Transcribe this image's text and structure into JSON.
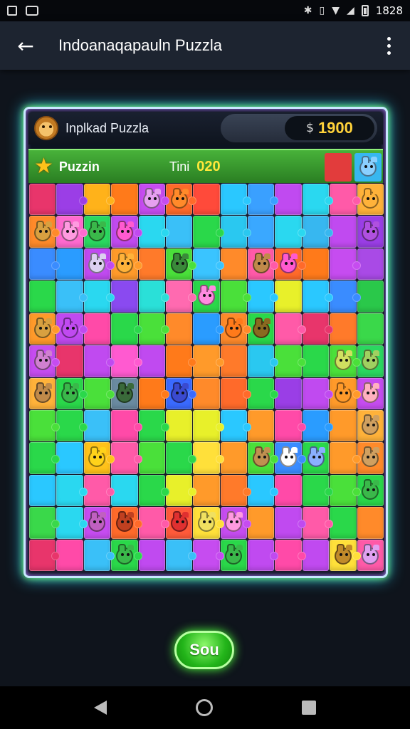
{
  "status_bar": {
    "time": "1828"
  },
  "app_bar": {
    "title": "Indoanaqapauln Puzzla"
  },
  "panel": {
    "title": "Inplkad Puzzla",
    "coin_symbol": "$",
    "coins": "1900"
  },
  "info_bar": {
    "label": "Puzzin",
    "timer_label": "Tini",
    "timer_value": "020"
  },
  "colors": {
    "corner_tiles": [
      "#e23c3c",
      "#37b7f0"
    ],
    "grid": [
      [
        "#e8356b",
        "#9b3ee6",
        "#ffb21a",
        "#ff7a1a",
        "#c64cf0",
        "#ff6a2a",
        "#ff4a3a",
        "#2ac8ff",
        "#3aa0ff",
        "#c04af0",
        "#2ad8f0",
        "#ff5aa8",
        "#ffb23a"
      ],
      [
        "#ff8a2a",
        "#ff6ad0",
        "#2ad860",
        "#c04af0",
        "#2ad8f0",
        "#3ac0f8",
        "#2ad84a",
        "#2ac8f0",
        "#3aa8ff",
        "#2ad8f0",
        "#37b7f0",
        "#c04af0",
        "#9a3ee6"
      ],
      [
        "#3a8cff",
        "#2a9cff",
        "#c04af0",
        "#ff9a2a",
        "#ff7a2a",
        "#4ae03a",
        "#3ac4ff",
        "#ff8a2a",
        "#ff5aa8",
        "#ff6a2a",
        "#ff7a1a",
        "#c64cf0",
        "#a94ae6"
      ],
      [
        "#2ad84a",
        "#3ac0f8",
        "#2ad8f0",
        "#8a4af0",
        "#2ae0d8",
        "#ff6ab0",
        "#2ad84a",
        "#4ae03a",
        "#2ac8ff",
        "#e8f02a",
        "#2ac8ff",
        "#3a8cff",
        "#2ac84a"
      ],
      [
        "#ff9a2a",
        "#c04af0",
        "#ff4aa8",
        "#2ad84a",
        "#4ae03a",
        "#ff8a2a",
        "#2a9cff",
        "#ff8a2a",
        "#2ad84a",
        "#ff5aa8",
        "#e8356b",
        "#ff7a2a",
        "#3ad84a"
      ],
      [
        "#c64cf0",
        "#e8356b",
        "#c04af0",
        "#ff5ad0",
        "#c04af0",
        "#ff7a1a",
        "#ff9a2a",
        "#ff7a2a",
        "#2ac8f0",
        "#4ae03a",
        "#2ad84a",
        "#4ae03a",
        "#2ad860"
      ],
      [
        "#ffb23a",
        "#2ad84a",
        "#4ae03a",
        "#6a8aa0",
        "#ff7a1a",
        "#3a6aff",
        "#ff8a2a",
        "#ff6a2a",
        "#2ad84a",
        "#9a3ee6",
        "#c04af0",
        "#ff9a2a",
        "#c64cf0"
      ],
      [
        "#4ae03a",
        "#2ad84a",
        "#3ac0f8",
        "#ff4aa8",
        "#2ad84a",
        "#e8f02a",
        "#e8f02a",
        "#2ac8ff",
        "#ff9a2a",
        "#ff4aa8",
        "#2a9cff",
        "#ff9a2a",
        "#ffb23a"
      ],
      [
        "#2ad84a",
        "#2ac8ff",
        "#ffc21a",
        "#ff5aa8",
        "#4ae03a",
        "#2ad84a",
        "#ffe03a",
        "#ff9a2a",
        "#4ae03a",
        "#3a8cff",
        "#2ad84a",
        "#ff9a2a",
        "#ff8a2a"
      ],
      [
        "#2ac8ff",
        "#2ad8f0",
        "#ff5aa8",
        "#2ad8f0",
        "#2ad84a",
        "#e8f02a",
        "#ff9a2a",
        "#ff7a2a",
        "#2ac8ff",
        "#ff4aa8",
        "#2ad84a",
        "#4ae03a",
        "#2ad84a"
      ],
      [
        "#3ad84a",
        "#2ad8f0",
        "#c64cf0",
        "#ff6a2a",
        "#ff5aa8",
        "#ff5a3a",
        "#ffe03a",
        "#c64cf0",
        "#ff9a2a",
        "#c04af0",
        "#ff5aa8",
        "#2ad84a",
        "#ff8a2a"
      ],
      [
        "#e8356b",
        "#ff4aa8",
        "#3ac0f8",
        "#2ad84a",
        "#c04af0",
        "#3ac0f8",
        "#c64cf0",
        "#2ad84a",
        "#c04af0",
        "#ff4aa8",
        "#c04af0",
        "#ffe03a",
        "#ff5aa8"
      ]
    ],
    "critters": [
      [
        0,
        4,
        "#e6a0f0"
      ],
      [
        0,
        5,
        "#ff8a2a"
      ],
      [
        0,
        12,
        "#ffb23a"
      ],
      [
        1,
        0,
        "#d8a040"
      ],
      [
        1,
        1,
        "#ff9ae0"
      ],
      [
        1,
        2,
        "#3ab84a"
      ],
      [
        1,
        3,
        "#ff5ad0"
      ],
      [
        1,
        12,
        "#b050e0"
      ],
      [
        2,
        2,
        "#dcd0f0"
      ],
      [
        2,
        3,
        "#ffb23a"
      ],
      [
        2,
        5,
        "#3a8a3a"
      ],
      [
        2,
        8,
        "#c08a4a"
      ],
      [
        2,
        9,
        "#ff5ad0"
      ],
      [
        3,
        6,
        "#ff8ae0"
      ],
      [
        4,
        0,
        "#d8a040"
      ],
      [
        4,
        1,
        "#c04af0"
      ],
      [
        4,
        7,
        "#ff7a1a"
      ],
      [
        4,
        8,
        "#8a6a20"
      ],
      [
        5,
        0,
        "#d080d0"
      ],
      [
        5,
        11,
        "#d0e060"
      ],
      [
        5,
        12,
        "#a0d060"
      ],
      [
        6,
        0,
        "#c08a4a"
      ],
      [
        6,
        1,
        "#3ab84a"
      ],
      [
        6,
        3,
        "#3a6a3a"
      ],
      [
        6,
        5,
        "#3a4ad0"
      ],
      [
        6,
        11,
        "#ff9a2a"
      ],
      [
        6,
        12,
        "#ffb0c0"
      ],
      [
        7,
        12,
        "#d0a060"
      ],
      [
        8,
        2,
        "#ffd21a"
      ],
      [
        8,
        8,
        "#c09050"
      ],
      [
        8,
        9,
        "#ffffff"
      ],
      [
        8,
        10,
        "#8ab0ff"
      ],
      [
        8,
        12,
        "#d0a060"
      ],
      [
        9,
        12,
        "#3ab84a"
      ],
      [
        10,
        2,
        "#c060c0"
      ],
      [
        10,
        3,
        "#c04020"
      ],
      [
        10,
        5,
        "#e03030"
      ],
      [
        10,
        6,
        "#f0e060"
      ],
      [
        10,
        7,
        "#ff9ae0"
      ],
      [
        11,
        3,
        "#3ab84a"
      ],
      [
        11,
        7,
        "#3ab84a"
      ],
      [
        11,
        11,
        "#c08a2a"
      ],
      [
        11,
        12,
        "#e0a0f0"
      ]
    ]
  }
}
